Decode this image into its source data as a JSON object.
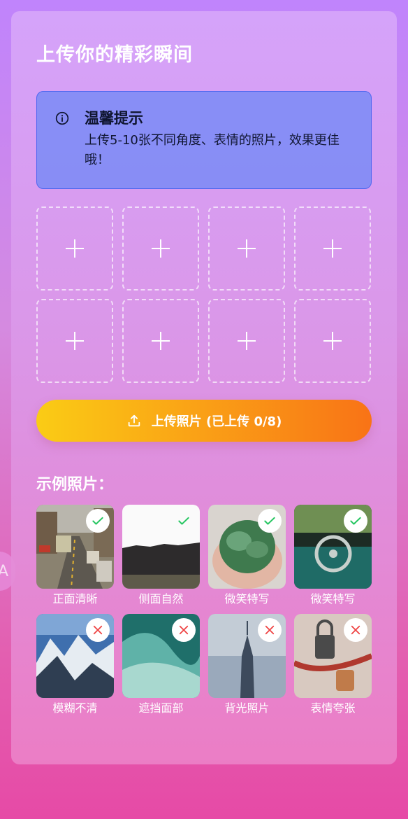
{
  "page": {
    "title": "上传你的精彩瞬间"
  },
  "tip": {
    "icon": "info-icon",
    "title": "温馨提示",
    "body": "上传5-10张不同角度、表情的照片，效果更佳哦！"
  },
  "upload_slots": {
    "count": 8,
    "icon": "plus-icon"
  },
  "upload_button": {
    "icon": "upload-icon",
    "label": "上传照片 (已上传 0/8)"
  },
  "examples": {
    "title": "示例照片：",
    "good": [
      {
        "label": "正面清晰",
        "icon": "check-icon"
      },
      {
        "label": "侧面自然",
        "icon": "check-icon"
      },
      {
        "label": "微笑特写",
        "icon": "check-icon"
      },
      {
        "label": "微笑特写",
        "icon": "check-icon"
      }
    ],
    "bad": [
      {
        "label": "模糊不清",
        "icon": "cross-icon"
      },
      {
        "label": "遮挡面部",
        "icon": "cross-icon"
      },
      {
        "label": "背光照片",
        "icon": "cross-icon"
      },
      {
        "label": "表情夸张",
        "icon": "cross-icon"
      }
    ]
  },
  "floating_bubble": {
    "text": "A"
  },
  "colors": {
    "check": "#22c55e",
    "cross": "#ef4444",
    "button_start": "#facc15",
    "button_end": "#f97316",
    "tip_border": "#4f67f0"
  }
}
